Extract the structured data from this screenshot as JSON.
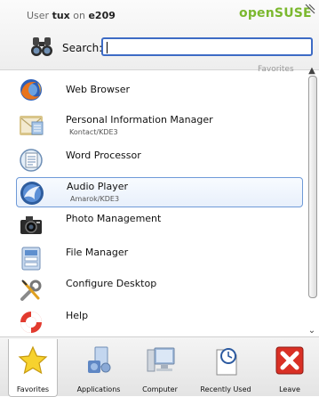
{
  "header": {
    "user_prefix": "User",
    "username": "tux",
    "on_word": "on",
    "hostname": "e209",
    "brand_open": "open",
    "brand_suse": "SUSE"
  },
  "search": {
    "label": "Search:",
    "value": ""
  },
  "section_label": "Favorites",
  "favorites": [
    {
      "title": "Web Browser",
      "subtitle": "",
      "icon": "firefox-icon"
    },
    {
      "title": "Personal Information Manager",
      "subtitle": "Kontact/KDE3",
      "icon": "pim-icon"
    },
    {
      "title": "Word Processor",
      "subtitle": "",
      "icon": "word-processor-icon"
    },
    {
      "title": "Audio Player",
      "subtitle": "Amarok/KDE3",
      "icon": "amarok-icon"
    },
    {
      "title": "Photo Management",
      "subtitle": "",
      "icon": "camera-icon"
    },
    {
      "title": "File Manager",
      "subtitle": "",
      "icon": "file-manager-icon"
    },
    {
      "title": "Configure Desktop",
      "subtitle": "",
      "icon": "tools-icon"
    },
    {
      "title": "Help",
      "subtitle": "",
      "icon": "lifebuoy-icon"
    }
  ],
  "tabs": [
    {
      "label": "Favorites",
      "icon": "star-icon",
      "active": true
    },
    {
      "label": "Applications",
      "icon": "applications-icon",
      "active": false
    },
    {
      "label": "Computer",
      "icon": "computer-icon",
      "active": false
    },
    {
      "label": "Recently Used",
      "icon": "clock-icon",
      "active": false
    },
    {
      "label": "Leave",
      "icon": "leave-icon",
      "active": false
    }
  ],
  "colors": {
    "brand_green": "#7bb82e",
    "selection_border": "#6f9ad8",
    "search_border": "#3d6bc5",
    "leave_red": "#d93025"
  }
}
